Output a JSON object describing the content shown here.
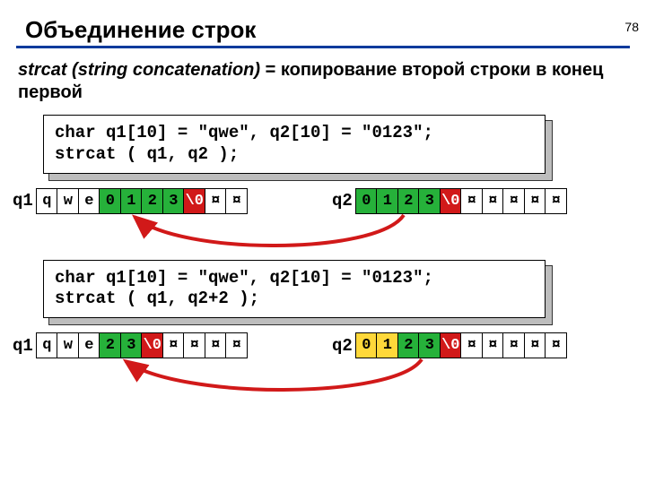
{
  "page_number": "78",
  "title": "Объединение строк",
  "subtitle_html": {
    "fn": "strcat",
    "paren": "(string concatenation)",
    "rest": " = копирование второй строки в конец первой"
  },
  "code1": "char q1[10] = \"qwe\", q2[10] = \"0123\";\nstrcat ( q1, q2 );",
  "code2": "char q1[10] = \"qwe\", q2[10] = \"0123\";\nstrcat ( q1, q2+2 );",
  "row1": {
    "q1_label": "q1",
    "q1_cells": [
      {
        "t": "q",
        "c": "c-white"
      },
      {
        "t": "w",
        "c": "c-white"
      },
      {
        "t": "e",
        "c": "c-white"
      },
      {
        "t": "0",
        "c": "c-green"
      },
      {
        "t": "1",
        "c": "c-green"
      },
      {
        "t": "2",
        "c": "c-green"
      },
      {
        "t": "3",
        "c": "c-green"
      },
      {
        "t": "\\0",
        "c": "c-red"
      },
      {
        "t": "¤",
        "c": "c-white"
      },
      {
        "t": "¤",
        "c": "c-white"
      }
    ],
    "q2_label": "q2",
    "q2_cells": [
      {
        "t": "0",
        "c": "c-green"
      },
      {
        "t": "1",
        "c": "c-green"
      },
      {
        "t": "2",
        "c": "c-green"
      },
      {
        "t": "3",
        "c": "c-green"
      },
      {
        "t": "\\0",
        "c": "c-red"
      },
      {
        "t": "¤",
        "c": "c-white"
      },
      {
        "t": "¤",
        "c": "c-white"
      },
      {
        "t": "¤",
        "c": "c-white"
      },
      {
        "t": "¤",
        "c": "c-white"
      },
      {
        "t": "¤",
        "c": "c-white"
      }
    ]
  },
  "row2": {
    "q1_label": "q1",
    "q1_cells": [
      {
        "t": "q",
        "c": "c-white"
      },
      {
        "t": "w",
        "c": "c-white"
      },
      {
        "t": "e",
        "c": "c-white"
      },
      {
        "t": "2",
        "c": "c-green"
      },
      {
        "t": "3",
        "c": "c-green"
      },
      {
        "t": "\\0",
        "c": "c-red"
      },
      {
        "t": "¤",
        "c": "c-white"
      },
      {
        "t": "¤",
        "c": "c-white"
      },
      {
        "t": "¤",
        "c": "c-white"
      },
      {
        "t": "¤",
        "c": "c-white"
      }
    ],
    "q2_label": "q2",
    "q2_cells": [
      {
        "t": "0",
        "c": "c-yellow"
      },
      {
        "t": "1",
        "c": "c-yellow"
      },
      {
        "t": "2",
        "c": "c-green"
      },
      {
        "t": "3",
        "c": "c-green"
      },
      {
        "t": "\\0",
        "c": "c-red"
      },
      {
        "t": "¤",
        "c": "c-white"
      },
      {
        "t": "¤",
        "c": "c-white"
      },
      {
        "t": "¤",
        "c": "c-white"
      },
      {
        "t": "¤",
        "c": "c-white"
      },
      {
        "t": "¤",
        "c": "c-white"
      }
    ]
  }
}
